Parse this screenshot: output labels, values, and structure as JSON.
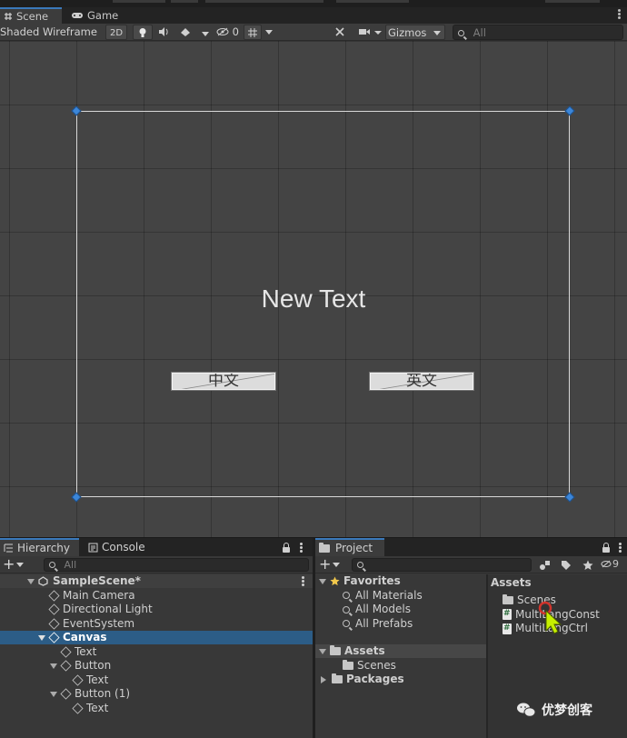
{
  "tabs": {
    "scene": "Scene",
    "game": "Game"
  },
  "scene_toolbar": {
    "shading_mode": "Shaded Wireframe",
    "mode_2d": "2D",
    "hidden_count": "0",
    "gizmos": "Gizmos",
    "search_placeholder": "All"
  },
  "scene": {
    "canvas_text": "New Text",
    "buttons": [
      "中文",
      "英文"
    ]
  },
  "hierarchy": {
    "tab_label": "Hierarchy",
    "console_label": "Console",
    "search_placeholder": "All",
    "items": [
      {
        "label": "SampleScene*",
        "depth": 0,
        "expanded": true,
        "bold": true,
        "icon": "unity-scene-icon"
      },
      {
        "label": "Main Camera",
        "depth": 1,
        "icon": "gameobject-icon"
      },
      {
        "label": "Directional Light",
        "depth": 1,
        "icon": "gameobject-icon"
      },
      {
        "label": "EventSystem",
        "depth": 1,
        "icon": "gameobject-icon"
      },
      {
        "label": "Canvas",
        "depth": 1,
        "expanded": true,
        "selected": true,
        "icon": "gameobject-icon"
      },
      {
        "label": "Text",
        "depth": 2,
        "icon": "gameobject-icon"
      },
      {
        "label": "Button",
        "depth": 2,
        "expanded": true,
        "icon": "gameobject-icon"
      },
      {
        "label": "Text",
        "depth": 3,
        "icon": "gameobject-icon"
      },
      {
        "label": "Button (1)",
        "depth": 2,
        "expanded": true,
        "icon": "gameobject-icon"
      },
      {
        "label": "Text",
        "depth": 3,
        "icon": "gameobject-icon"
      }
    ]
  },
  "project": {
    "tab_label": "Project",
    "hidden_packages_count": "9",
    "tree": {
      "favorites": "Favorites",
      "favorite_items": [
        "All Materials",
        "All Models",
        "All Prefabs"
      ],
      "assets": "Assets",
      "asset_items": [
        "Scenes"
      ],
      "packages": "Packages"
    },
    "breadcrumb": "Assets",
    "files": [
      {
        "label": "Scenes",
        "icon": "folder-icon"
      },
      {
        "label": "MultiLangConst",
        "icon": "script-icon"
      },
      {
        "label": "MultiLangCtrl",
        "icon": "script-icon"
      }
    ]
  },
  "watermark": "优梦创客",
  "colors": {
    "selection": "#2c5d87",
    "accent": "#3a79bb",
    "handle": "#3c86d8",
    "cursor": "#c6f000"
  }
}
